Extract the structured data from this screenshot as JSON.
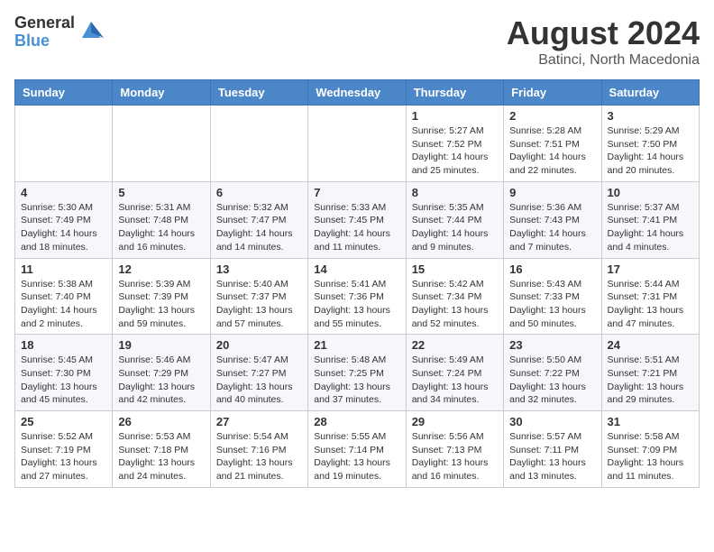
{
  "logo": {
    "general": "General",
    "blue": "Blue"
  },
  "header": {
    "month_year": "August 2024",
    "location": "Batinci, North Macedonia"
  },
  "weekdays": [
    "Sunday",
    "Monday",
    "Tuesday",
    "Wednesday",
    "Thursday",
    "Friday",
    "Saturday"
  ],
  "weeks": [
    [
      {
        "day": "",
        "info": ""
      },
      {
        "day": "",
        "info": ""
      },
      {
        "day": "",
        "info": ""
      },
      {
        "day": "",
        "info": ""
      },
      {
        "day": "1",
        "info": "Sunrise: 5:27 AM\nSunset: 7:52 PM\nDaylight: 14 hours\nand 25 minutes."
      },
      {
        "day": "2",
        "info": "Sunrise: 5:28 AM\nSunset: 7:51 PM\nDaylight: 14 hours\nand 22 minutes."
      },
      {
        "day": "3",
        "info": "Sunrise: 5:29 AM\nSunset: 7:50 PM\nDaylight: 14 hours\nand 20 minutes."
      }
    ],
    [
      {
        "day": "4",
        "info": "Sunrise: 5:30 AM\nSunset: 7:49 PM\nDaylight: 14 hours\nand 18 minutes."
      },
      {
        "day": "5",
        "info": "Sunrise: 5:31 AM\nSunset: 7:48 PM\nDaylight: 14 hours\nand 16 minutes."
      },
      {
        "day": "6",
        "info": "Sunrise: 5:32 AM\nSunset: 7:47 PM\nDaylight: 14 hours\nand 14 minutes."
      },
      {
        "day": "7",
        "info": "Sunrise: 5:33 AM\nSunset: 7:45 PM\nDaylight: 14 hours\nand 11 minutes."
      },
      {
        "day": "8",
        "info": "Sunrise: 5:35 AM\nSunset: 7:44 PM\nDaylight: 14 hours\nand 9 minutes."
      },
      {
        "day": "9",
        "info": "Sunrise: 5:36 AM\nSunset: 7:43 PM\nDaylight: 14 hours\nand 7 minutes."
      },
      {
        "day": "10",
        "info": "Sunrise: 5:37 AM\nSunset: 7:41 PM\nDaylight: 14 hours\nand 4 minutes."
      }
    ],
    [
      {
        "day": "11",
        "info": "Sunrise: 5:38 AM\nSunset: 7:40 PM\nDaylight: 14 hours\nand 2 minutes."
      },
      {
        "day": "12",
        "info": "Sunrise: 5:39 AM\nSunset: 7:39 PM\nDaylight: 13 hours\nand 59 minutes."
      },
      {
        "day": "13",
        "info": "Sunrise: 5:40 AM\nSunset: 7:37 PM\nDaylight: 13 hours\nand 57 minutes."
      },
      {
        "day": "14",
        "info": "Sunrise: 5:41 AM\nSunset: 7:36 PM\nDaylight: 13 hours\nand 55 minutes."
      },
      {
        "day": "15",
        "info": "Sunrise: 5:42 AM\nSunset: 7:34 PM\nDaylight: 13 hours\nand 52 minutes."
      },
      {
        "day": "16",
        "info": "Sunrise: 5:43 AM\nSunset: 7:33 PM\nDaylight: 13 hours\nand 50 minutes."
      },
      {
        "day": "17",
        "info": "Sunrise: 5:44 AM\nSunset: 7:31 PM\nDaylight: 13 hours\nand 47 minutes."
      }
    ],
    [
      {
        "day": "18",
        "info": "Sunrise: 5:45 AM\nSunset: 7:30 PM\nDaylight: 13 hours\nand 45 minutes."
      },
      {
        "day": "19",
        "info": "Sunrise: 5:46 AM\nSunset: 7:29 PM\nDaylight: 13 hours\nand 42 minutes."
      },
      {
        "day": "20",
        "info": "Sunrise: 5:47 AM\nSunset: 7:27 PM\nDaylight: 13 hours\nand 40 minutes."
      },
      {
        "day": "21",
        "info": "Sunrise: 5:48 AM\nSunset: 7:25 PM\nDaylight: 13 hours\nand 37 minutes."
      },
      {
        "day": "22",
        "info": "Sunrise: 5:49 AM\nSunset: 7:24 PM\nDaylight: 13 hours\nand 34 minutes."
      },
      {
        "day": "23",
        "info": "Sunrise: 5:50 AM\nSunset: 7:22 PM\nDaylight: 13 hours\nand 32 minutes."
      },
      {
        "day": "24",
        "info": "Sunrise: 5:51 AM\nSunset: 7:21 PM\nDaylight: 13 hours\nand 29 minutes."
      }
    ],
    [
      {
        "day": "25",
        "info": "Sunrise: 5:52 AM\nSunset: 7:19 PM\nDaylight: 13 hours\nand 27 minutes."
      },
      {
        "day": "26",
        "info": "Sunrise: 5:53 AM\nSunset: 7:18 PM\nDaylight: 13 hours\nand 24 minutes."
      },
      {
        "day": "27",
        "info": "Sunrise: 5:54 AM\nSunset: 7:16 PM\nDaylight: 13 hours\nand 21 minutes."
      },
      {
        "day": "28",
        "info": "Sunrise: 5:55 AM\nSunset: 7:14 PM\nDaylight: 13 hours\nand 19 minutes."
      },
      {
        "day": "29",
        "info": "Sunrise: 5:56 AM\nSunset: 7:13 PM\nDaylight: 13 hours\nand 16 minutes."
      },
      {
        "day": "30",
        "info": "Sunrise: 5:57 AM\nSunset: 7:11 PM\nDaylight: 13 hours\nand 13 minutes."
      },
      {
        "day": "31",
        "info": "Sunrise: 5:58 AM\nSunset: 7:09 PM\nDaylight: 13 hours\nand 11 minutes."
      }
    ]
  ]
}
